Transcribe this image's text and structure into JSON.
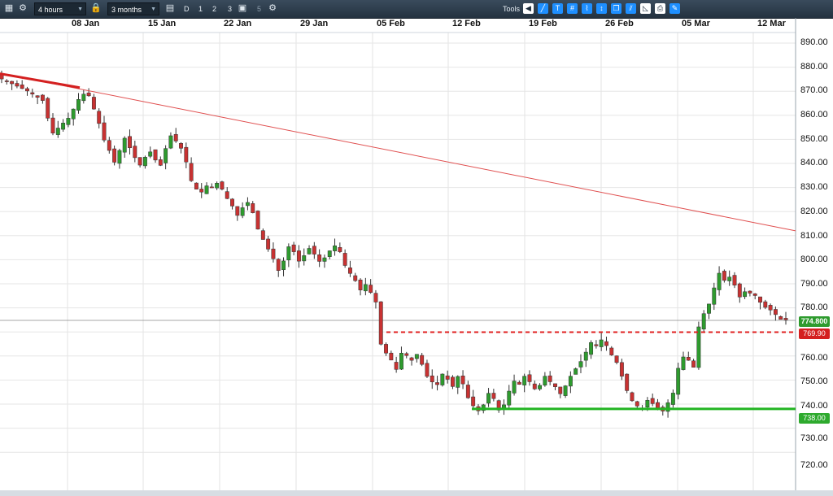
{
  "toolbar": {
    "timeframe": "4 hours",
    "range": "3 months",
    "intervals": [
      "D",
      "1",
      "2",
      "3",
      "5"
    ],
    "tools_label": "Tools"
  },
  "chart_data": {
    "type": "candlestick",
    "x_labels": [
      "08 Jan",
      "15 Jan",
      "22 Jan",
      "29 Jan",
      "05 Feb",
      "12 Feb",
      "19 Feb",
      "26 Feb",
      "05 Mar",
      "12 Mar"
    ],
    "y_ticks": [
      "890.00",
      "880.00",
      "870.00",
      "860.00",
      "850.00",
      "840.00",
      "830.00",
      "820.00",
      "810.00",
      "800.00",
      "790.00",
      "780.00",
      "770.00",
      "760.00",
      "750.00",
      "740.00",
      "730.00",
      "720.00"
    ],
    "ylim": [
      715,
      893
    ],
    "grid": true,
    "current_price": "774.800",
    "lines": [
      {
        "name": "resistance",
        "value": 769.9,
        "label": "769.90",
        "color": "#e02020",
        "style": "dashed"
      },
      {
        "name": "support",
        "value": 738.0,
        "label": "738.00",
        "color": "#22b422",
        "style": "solid"
      }
    ],
    "trendline": {
      "from": [
        "start",
        877.5
      ],
      "to": [
        "end",
        812
      ],
      "color": "#e05050"
    },
    "colors": {
      "up": "#2e9b2e",
      "down": "#c83232",
      "background": "#ffffff",
      "grid": "#e6e6e6"
    },
    "path": [
      [
        0,
        876
      ],
      [
        3,
        873
      ],
      [
        6,
        870
      ],
      [
        9,
        866
      ],
      [
        10,
        858
      ],
      [
        11,
        852
      ],
      [
        12,
        855
      ],
      [
        14,
        859
      ],
      [
        15,
        863
      ],
      [
        16,
        867
      ],
      [
        17,
        869
      ],
      [
        18,
        868
      ],
      [
        19,
        862
      ],
      [
        20,
        856
      ],
      [
        21,
        849
      ],
      [
        22,
        845
      ],
      [
        23,
        840
      ],
      [
        24,
        846
      ],
      [
        25,
        851
      ],
      [
        26,
        846
      ],
      [
        27,
        842
      ],
      [
        28,
        839
      ],
      [
        29,
        843
      ],
      [
        30,
        845
      ],
      [
        31,
        841
      ],
      [
        32,
        839
      ],
      [
        33,
        847
      ],
      [
        34,
        852
      ],
      [
        35,
        849
      ],
      [
        36,
        846
      ],
      [
        37,
        840
      ],
      [
        38,
        832
      ],
      [
        39,
        829
      ],
      [
        40,
        828
      ],
      [
        41,
        831
      ],
      [
        42,
        830
      ],
      [
        43,
        832
      ],
      [
        44,
        829
      ],
      [
        45,
        825
      ],
      [
        46,
        822
      ],
      [
        47,
        818
      ],
      [
        48,
        822
      ],
      [
        49,
        824
      ],
      [
        50,
        819
      ],
      [
        51,
        812
      ],
      [
        52,
        808
      ],
      [
        53,
        804
      ],
      [
        54,
        800
      ],
      [
        55,
        795
      ],
      [
        56,
        800
      ],
      [
        57,
        806
      ],
      [
        58,
        803
      ],
      [
        59,
        799
      ],
      [
        60,
        802
      ],
      [
        61,
        805
      ],
      [
        62,
        802
      ],
      [
        63,
        799
      ],
      [
        64,
        801
      ],
      [
        65,
        804
      ],
      [
        66,
        806
      ],
      [
        67,
        803
      ],
      [
        68,
        797
      ],
      [
        69,
        794
      ],
      [
        70,
        791
      ],
      [
        71,
        787
      ],
      [
        72,
        790
      ],
      [
        73,
        786
      ],
      [
        74,
        782
      ],
      [
        75,
        763
      ],
      [
        76,
        761
      ],
      [
        77,
        758
      ],
      [
        78,
        754
      ],
      [
        79,
        762
      ],
      [
        80,
        760
      ],
      [
        81,
        758
      ],
      [
        82,
        761
      ],
      [
        83,
        756
      ],
      [
        84,
        751
      ],
      [
        85,
        749
      ],
      [
        86,
        748
      ],
      [
        87,
        753
      ],
      [
        88,
        750
      ],
      [
        89,
        747
      ],
      [
        90,
        752
      ],
      [
        91,
        748
      ],
      [
        92,
        742
      ],
      [
        93,
        739
      ],
      [
        94,
        737
      ],
      [
        95,
        740
      ],
      [
        96,
        745
      ],
      [
        97,
        742
      ],
      [
        98,
        737
      ],
      [
        99,
        740
      ],
      [
        100,
        746
      ],
      [
        101,
        750
      ],
      [
        102,
        748
      ],
      [
        103,
        752
      ],
      [
        104,
        749
      ],
      [
        105,
        746
      ],
      [
        106,
        748
      ],
      [
        107,
        752
      ],
      [
        108,
        749
      ],
      [
        109,
        747
      ],
      [
        110,
        744
      ],
      [
        111,
        748
      ],
      [
        112,
        752
      ],
      [
        113,
        755
      ],
      [
        114,
        758
      ],
      [
        115,
        762
      ],
      [
        116,
        766
      ],
      [
        117,
        764
      ],
      [
        118,
        767
      ],
      [
        119,
        764
      ],
      [
        120,
        760
      ],
      [
        121,
        757
      ],
      [
        122,
        751
      ],
      [
        123,
        745
      ],
      [
        124,
        741
      ],
      [
        125,
        739
      ],
      [
        126,
        738
      ],
      [
        127,
        742
      ],
      [
        128,
        740
      ],
      [
        129,
        738
      ],
      [
        130,
        737
      ],
      [
        131,
        741
      ],
      [
        132,
        745
      ],
      [
        133,
        756
      ],
      [
        134,
        760
      ],
      [
        135,
        758
      ],
      [
        136,
        755
      ],
      [
        137,
        774
      ],
      [
        138,
        778
      ],
      [
        139,
        782
      ],
      [
        140,
        789
      ],
      [
        141,
        795
      ],
      [
        142,
        791
      ],
      [
        143,
        793
      ],
      [
        144,
        789
      ],
      [
        145,
        784
      ],
      [
        146,
        787
      ],
      [
        147,
        786
      ],
      [
        148,
        785
      ],
      [
        149,
        782
      ],
      [
        150,
        780
      ],
      [
        151,
        779
      ],
      [
        152,
        777
      ],
      [
        153,
        775
      ]
    ]
  }
}
